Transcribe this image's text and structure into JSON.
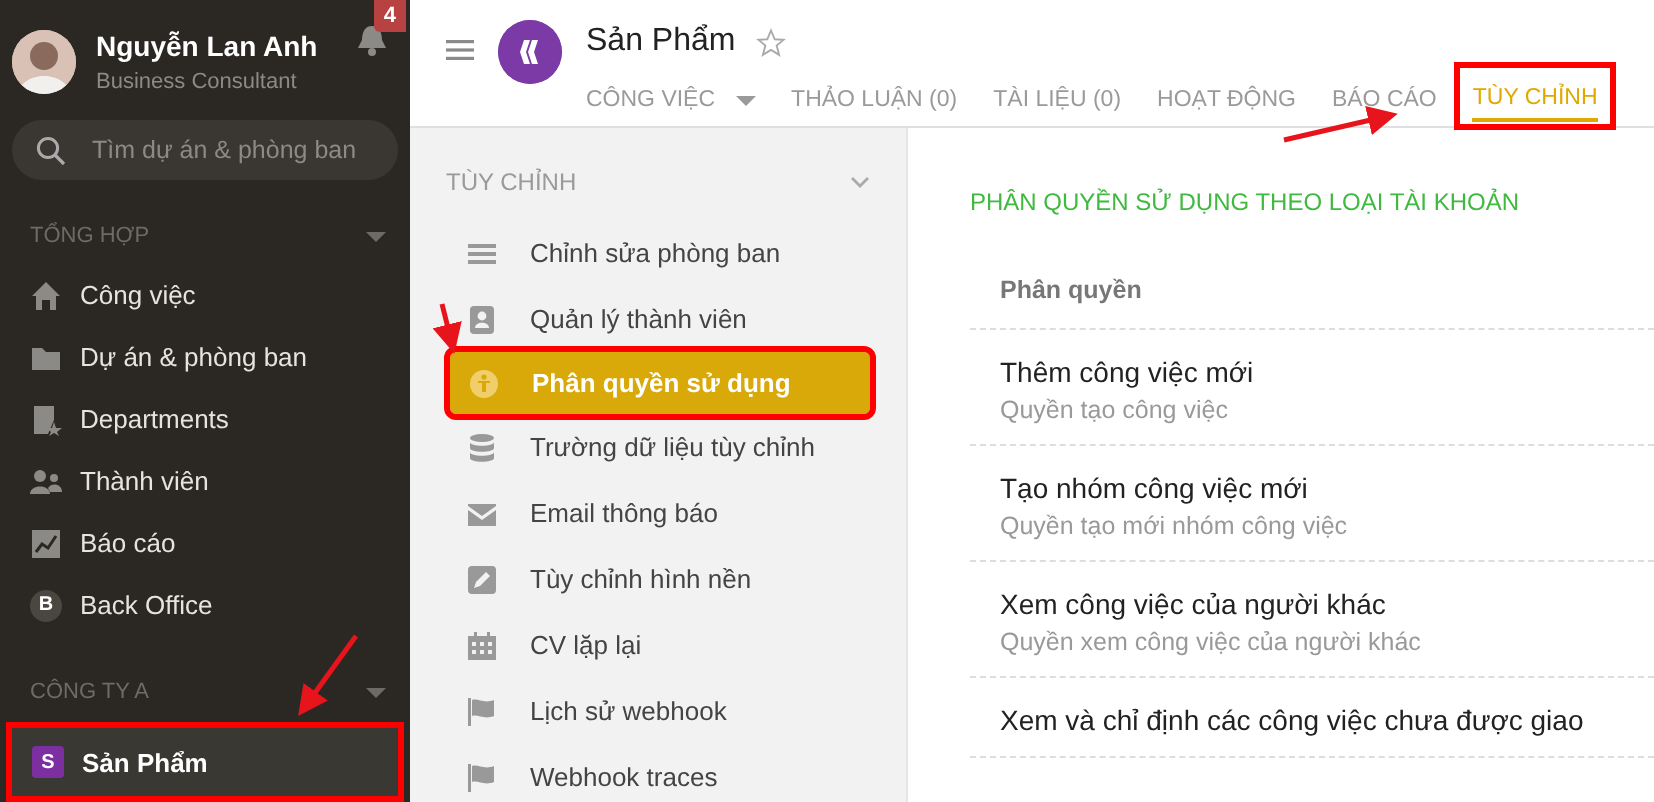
{
  "user": {
    "name": "Nguyễn Lan Anh",
    "role": "Business Consultant",
    "notifications": "4"
  },
  "search": {
    "placeholder": "Tìm dự án & phòng ban"
  },
  "sidebar": {
    "sections": [
      {
        "title": "TỔNG HỢP",
        "items": [
          {
            "label": "Công việc",
            "kind": "home",
            "selected": false,
            "annotated": false
          },
          {
            "label": "Dự án & phòng ban",
            "kind": "folder",
            "selected": false,
            "annotated": false
          },
          {
            "label": "Departments",
            "kind": "doc",
            "selected": false,
            "annotated": false
          },
          {
            "label": "Thành viên",
            "kind": "people",
            "selected": false,
            "annotated": false
          },
          {
            "label": "Báo cáo",
            "kind": "chart",
            "selected": false,
            "annotated": false
          },
          {
            "label": "Back Office",
            "kind": "letter",
            "letter": "B",
            "selected": false,
            "annotated": false
          }
        ]
      },
      {
        "title": "CÔNG TY A",
        "items": [
          {
            "label": "Sản Phẩm",
            "kind": "square",
            "letter": "S",
            "color": "#7b2fa0",
            "selected": true,
            "annotated": true
          }
        ]
      }
    ]
  },
  "header": {
    "title": "Sản Phẩm",
    "starred": false,
    "tabs": [
      {
        "label": "CÔNG VIỆC",
        "has_menu": true,
        "selected": false,
        "annotated": false
      },
      {
        "label": "THẢO LUẬN (0)",
        "has_menu": false,
        "selected": false,
        "annotated": false
      },
      {
        "label": "TÀI LIỆU (0)",
        "has_menu": false,
        "selected": false,
        "annotated": false
      },
      {
        "label": "HOẠT ĐỘNG",
        "has_menu": false,
        "selected": false,
        "annotated": false
      },
      {
        "label": "BÁO CÁO",
        "has_menu": false,
        "selected": false,
        "annotated": false
      },
      {
        "label": "TÙY CHỈNH",
        "has_menu": false,
        "selected": true,
        "annotated": true
      }
    ]
  },
  "settings_menu": {
    "title": "TÙY CHỈNH",
    "expanded": true,
    "items": [
      {
        "label": "Chỉnh sửa phòng ban",
        "kind": "lines",
        "selected": false,
        "annotated": false
      },
      {
        "label": "Quản lý thành viên",
        "kind": "contact",
        "selected": false,
        "annotated": false
      },
      {
        "label": "Phân quyền sử dụng",
        "kind": "person-circle",
        "selected": true,
        "annotated": true
      },
      {
        "label": "Trường dữ liệu tùy chỉnh",
        "kind": "database",
        "selected": false,
        "annotated": false
      },
      {
        "label": "Email thông báo",
        "kind": "mail",
        "selected": false,
        "annotated": false
      },
      {
        "label": "Tùy chỉnh hình nền",
        "kind": "pencil",
        "selected": false,
        "annotated": false
      },
      {
        "label": "CV lặp lại",
        "kind": "calendar",
        "selected": false,
        "annotated": false
      },
      {
        "label": "Lịch sử webhook",
        "kind": "flag",
        "selected": false,
        "annotated": false
      },
      {
        "label": "Webhook traces",
        "kind": "flag",
        "selected": false,
        "annotated": false
      }
    ]
  },
  "content": {
    "title": "PHÂN QUYỀN SỬ DỤNG THEO LOẠI TÀI KHOẢN",
    "table": {
      "columns": [
        "Phân quyền"
      ],
      "rows": [
        {
          "name": "Thêm công việc mới",
          "description": "Quyền tạo công việc"
        },
        {
          "name": "Tạo nhóm công việc mới",
          "description": "Quyền tạo mới nhóm công việc"
        },
        {
          "name": "Xem công việc của người khác",
          "description": "Quyền xem công việc của người khác"
        },
        {
          "name": "Xem và chỉ định các công việc chưa được giao"
        }
      ]
    }
  }
}
